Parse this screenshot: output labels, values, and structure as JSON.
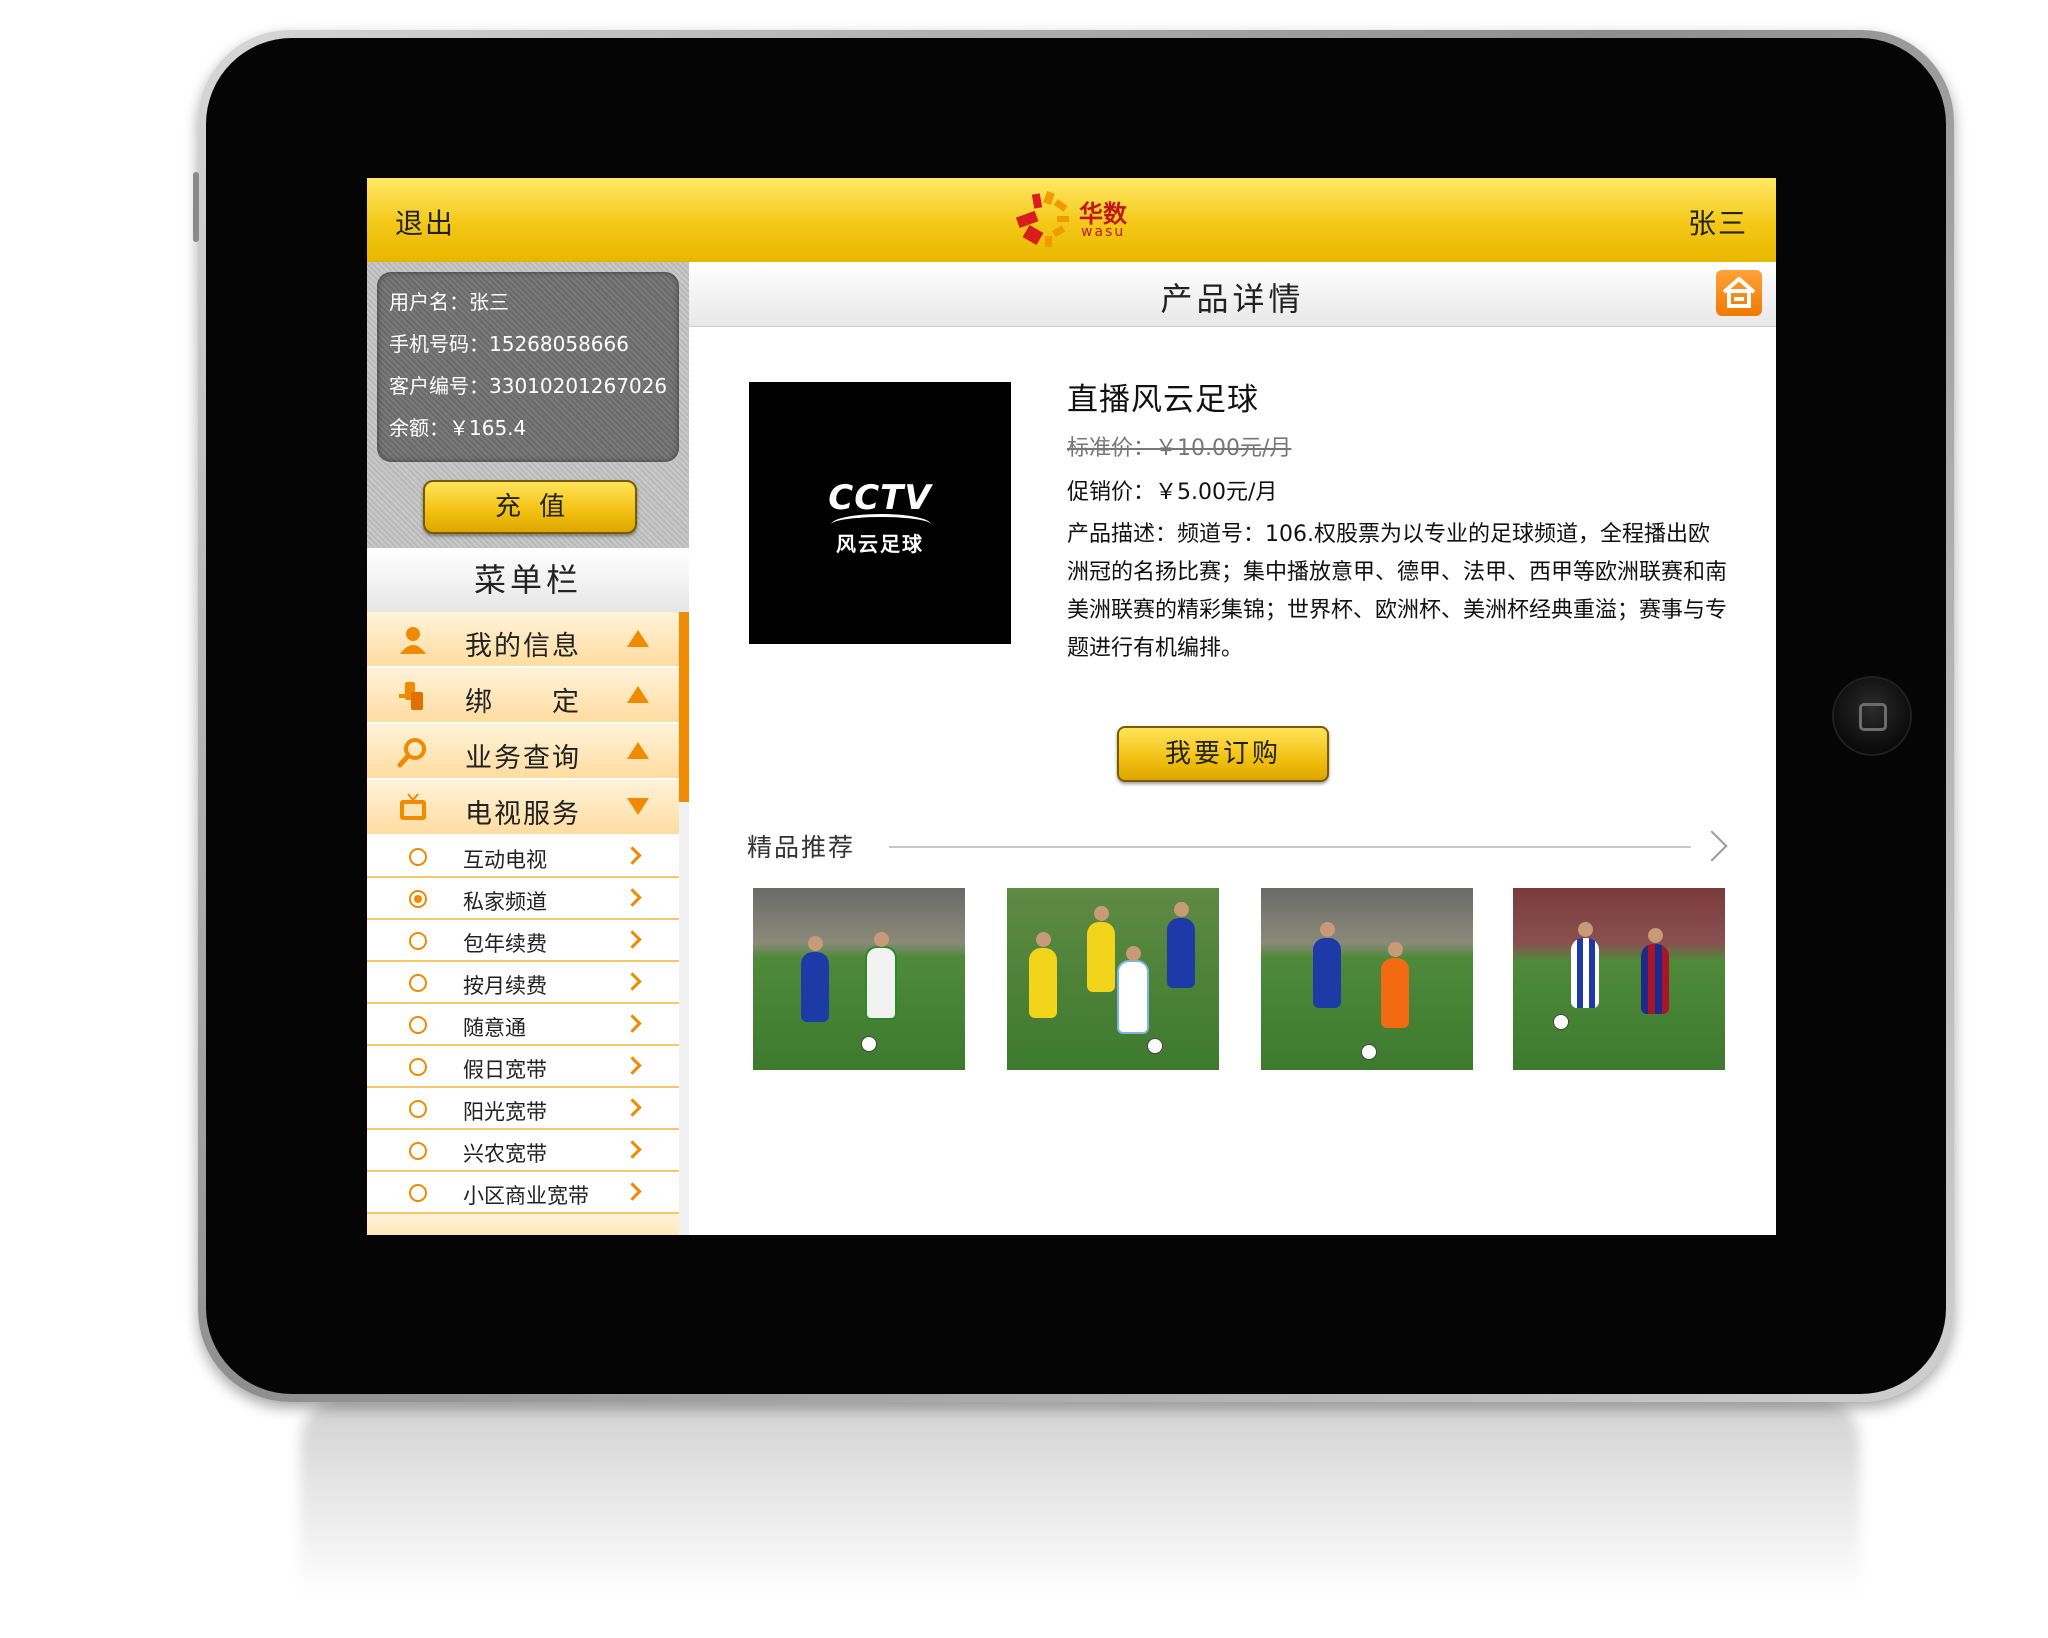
{
  "header": {
    "exit_label": "退出",
    "user_label": "张三",
    "logo_cn": "华数",
    "logo_en": "wasu"
  },
  "account": {
    "username": "用户名：张三",
    "phone": "手机号码：15268058666",
    "customer_id": "客户编号：33010201267026",
    "balance": "余额：￥165.4",
    "recharge_label": "充值"
  },
  "menu": {
    "title": "菜单栏",
    "items": [
      {
        "label": "我的信息",
        "icon": "person-icon",
        "state": "collapsed"
      },
      {
        "label": "绑　　定",
        "icon": "bind-icon",
        "state": "collapsed"
      },
      {
        "label": "业务查询",
        "icon": "search-icon",
        "state": "collapsed"
      },
      {
        "label": "电视服务",
        "icon": "tv-icon",
        "state": "expanded"
      }
    ],
    "sub_items": [
      {
        "label": "互动电视",
        "selected": false
      },
      {
        "label": "私家频道",
        "selected": true
      },
      {
        "label": "包年续费",
        "selected": false
      },
      {
        "label": "按月续费",
        "selected": false
      },
      {
        "label": "随意通",
        "selected": false
      },
      {
        "label": "假日宽带",
        "selected": false
      },
      {
        "label": "阳光宽带",
        "selected": false
      },
      {
        "label": "兴农宽带",
        "selected": false
      },
      {
        "label": "小区商业宽带",
        "selected": false
      }
    ]
  },
  "main": {
    "title": "产品详情",
    "product": {
      "logo_text": "CCTV",
      "logo_sub": "风云足球",
      "name": "直播风云足球",
      "standard_price": "标准价：￥10.00元/月",
      "promo_price": "促销价：￥5.00元/月",
      "description": "产品描述：频道号：106.权股票为以专业的足球频道，全程播出欧洲冠的名扬比赛；集中播放意甲、德甲、法甲、西甲等欧洲联赛和南美洲联赛的精彩集锦；世界杯、欧洲杯、美洲杯经典重溢；赛事与专题进行有机编排。"
    },
    "buy_label": "我要订购",
    "recommend_title": "精品推荐"
  },
  "colors": {
    "brand_yellow": "#f4c817",
    "accent_orange": "#f08a00",
    "logo_red": "#c01818"
  }
}
